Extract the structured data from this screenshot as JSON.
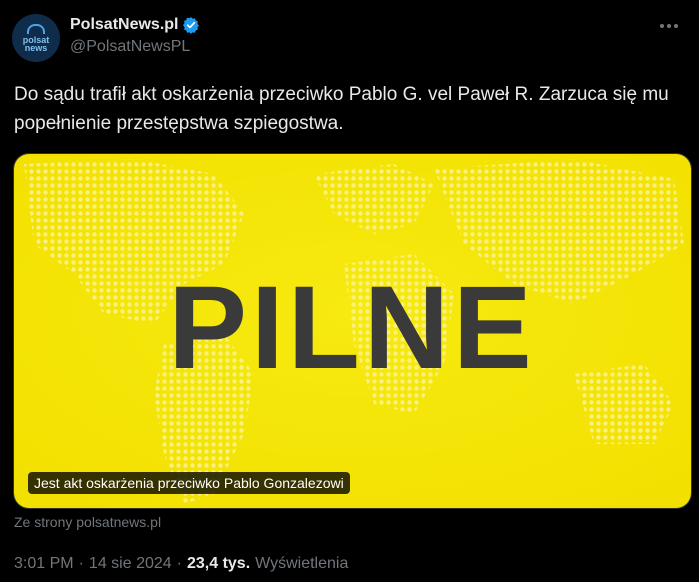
{
  "author": {
    "display_name": "PolsatNews.pl",
    "handle": "@PolsatNewsPL",
    "avatar_text_line1": "polsat",
    "avatar_text_line2": "news",
    "verified_icon": "verified-badge-icon",
    "verified_color": "#1d9bf0"
  },
  "tweet": {
    "text": "Do sądu trafił akt oskarżenia przeciwko Pablo G. vel Paweł R. Zarzuca się mu popełnienie przestępstwa szpiegostwa."
  },
  "media": {
    "headline": "PILNE",
    "caption": "Jest akt oskarżenia przeciwko Pablo Gonzalezowi",
    "background_color": "#f5e500",
    "headline_color": "#3a3a3a"
  },
  "link_source": "Ze strony polsatnews.pl",
  "meta": {
    "time": "3:01 PM",
    "separator": "·",
    "date": "14 sie 2024",
    "views_count": "23,4 tys.",
    "views_label": "Wyświetlenia"
  },
  "more_icon": "more-dots-icon"
}
